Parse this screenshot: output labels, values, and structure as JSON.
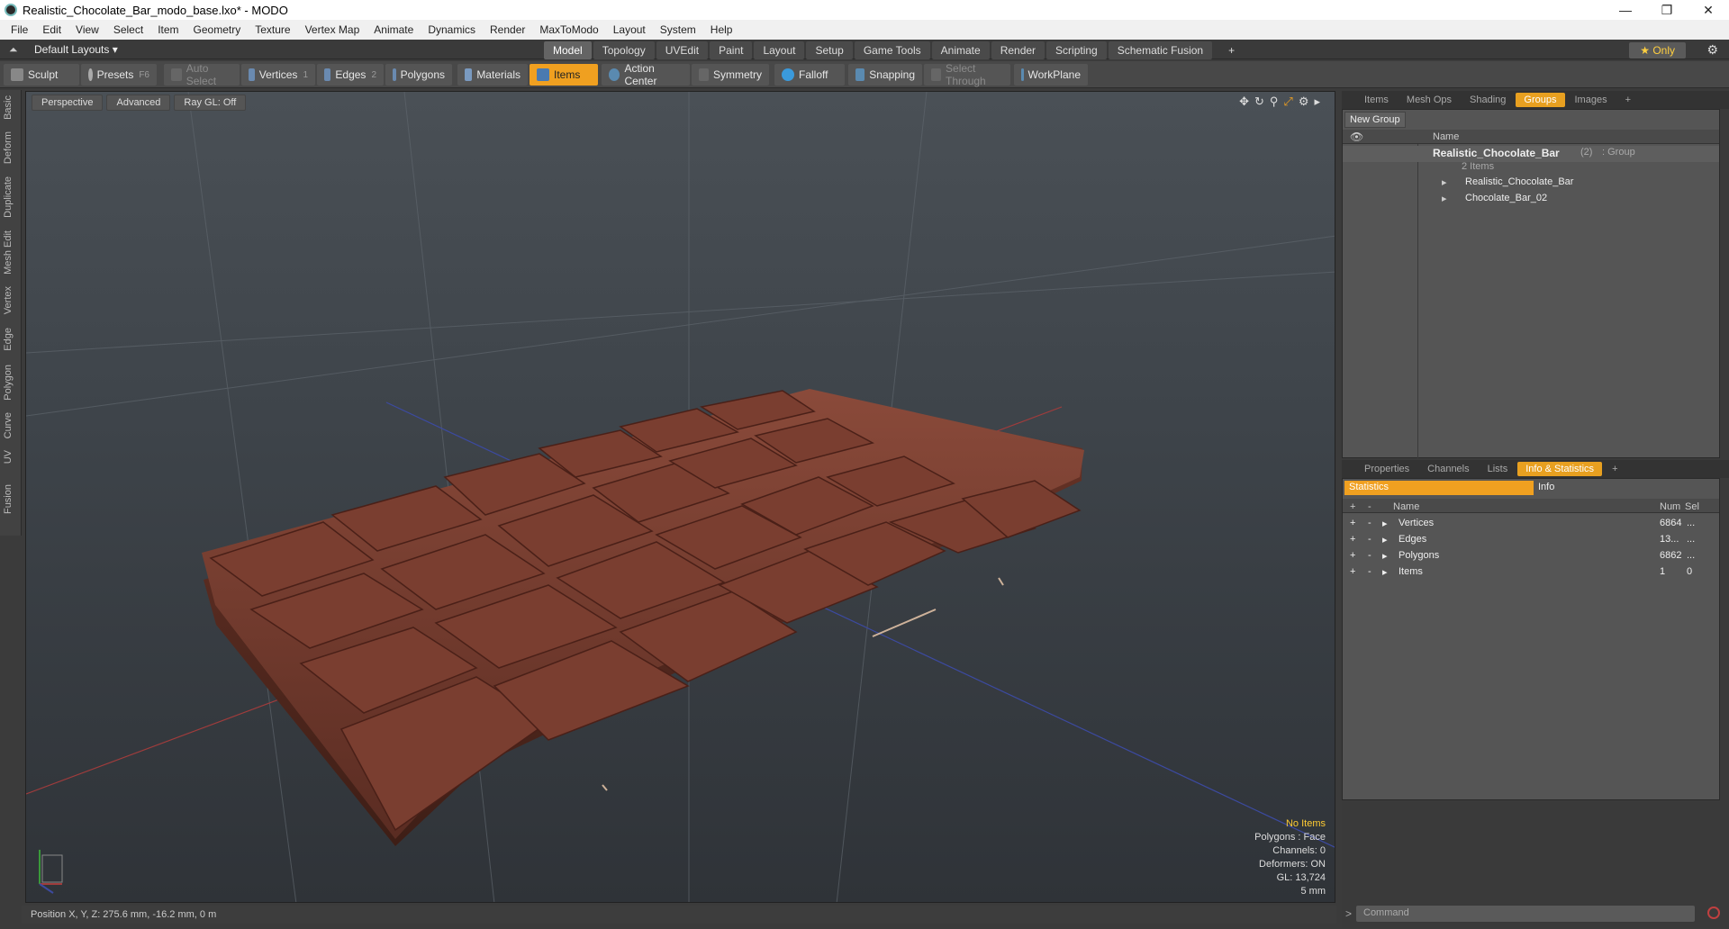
{
  "window": {
    "title": "Realistic_Chocolate_Bar_modo_base.lxo* - MODO"
  },
  "menu": [
    "File",
    "Edit",
    "View",
    "Select",
    "Item",
    "Geometry",
    "Texture",
    "Vertex Map",
    "Animate",
    "Dynamics",
    "Render",
    "MaxToModo",
    "Layout",
    "System",
    "Help"
  ],
  "layouts": "Default Layouts ▾",
  "tabs": [
    "Model",
    "Topology",
    "UVEdit",
    "Paint",
    "Layout",
    "Setup",
    "Game Tools",
    "Animate",
    "Render",
    "Scripting",
    "Schematic Fusion"
  ],
  "only": "★ Only",
  "toolbar": {
    "sculpt": "Sculpt",
    "presets": "Presets",
    "presets_key": "F6",
    "auto_select": "Auto Select",
    "vertices": "Vertices",
    "vertices_key": "1",
    "edges": "Edges",
    "edges_key": "2",
    "polygons": "Polygons",
    "materials": "Materials",
    "items": "Items",
    "action_center": "Action Center",
    "symmetry": "Symmetry",
    "falloff": "Falloff",
    "snapping": "Snapping",
    "select_through": "Select Through",
    "workplane": "WorkPlane"
  },
  "left_tabs": [
    "Basic",
    "Deform",
    "Duplicate",
    "Mesh Edit",
    "Vertex",
    "Edge",
    "Polygon",
    "Curve",
    "UV",
    "Fusion"
  ],
  "viewport": {
    "perspective": "Perspective",
    "advanced": "Advanced",
    "raygl": "Ray GL: Off",
    "info": {
      "no_items": "No Items",
      "polygons": "Polygons : Face",
      "channels": "Channels: 0",
      "deformers": "Deformers: ON",
      "gl": "GL: 13,724",
      "scale": "5 mm"
    }
  },
  "status": "Position X, Y, Z:   275.6 mm, -16.2 mm, 0 m",
  "top_panel": {
    "tabs": [
      "Items",
      "Mesh Ops",
      "Shading",
      "Groups",
      "Images"
    ],
    "active": "Groups",
    "new_group": "New Group",
    "name_header": "Name",
    "group": {
      "name": "Realistic_Chocolate_Bar",
      "count": "(2)",
      "type": ": Group",
      "sub": "2 Items"
    },
    "children": [
      "Realistic_Chocolate_Bar",
      "Chocolate_Bar_02"
    ]
  },
  "bottom_panel": {
    "tabs": [
      "Properties",
      "Channels",
      "Lists",
      "Info & Statistics"
    ],
    "active": "Info & Statistics",
    "statistics": "Statistics",
    "info": "Info",
    "headers": {
      "name": "Name",
      "num": "Num",
      "sel": "Sel"
    },
    "rows": [
      {
        "name": "Vertices",
        "num": "6864",
        "sel": "..."
      },
      {
        "name": "Edges",
        "num": "13...",
        "sel": "..."
      },
      {
        "name": "Polygons",
        "num": "6862",
        "sel": "..."
      },
      {
        "name": "Items",
        "num": "1",
        "sel": "0"
      }
    ]
  },
  "command_placeholder": "Command",
  "colors": {
    "accent": "#f0a020",
    "chocolate": "#6a3428"
  }
}
